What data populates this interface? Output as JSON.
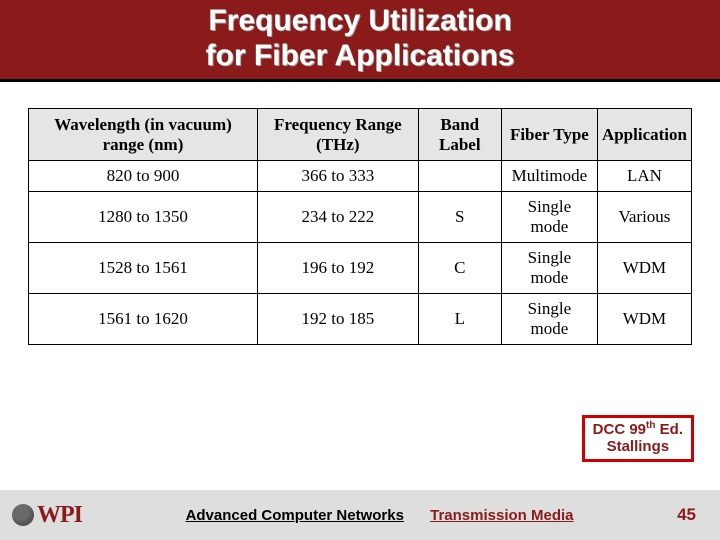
{
  "title_line1": "Frequency Utilization",
  "title_line2": "for Fiber Applications",
  "chart_data": {
    "type": "table",
    "headers": [
      "Wavelength (in vacuum) range (nm)",
      "Frequency Range (THz)",
      "Band Label",
      "Fiber Type",
      "Application"
    ],
    "rows": [
      {
        "wavelength": "820 to 900",
        "frequency": "366 to 333",
        "band": "",
        "fiber": "Multimode",
        "app": "LAN"
      },
      {
        "wavelength": "1280 to 1350",
        "frequency": "234 to 222",
        "band": "S",
        "fiber": "Single mode",
        "app": "Various"
      },
      {
        "wavelength": "1528 to 1561",
        "frequency": "196 to 192",
        "band": "C",
        "fiber": "Single mode",
        "app": "WDM"
      },
      {
        "wavelength": "1561 to 1620",
        "frequency": "192 to 185",
        "band": "L",
        "fiber": "Single mode",
        "app": "WDM"
      }
    ]
  },
  "credit": {
    "line1_a": "DCC 99",
    "line1_sup": "th",
    "line1_b": " Ed.",
    "line2": "Stallings"
  },
  "footer": {
    "logo_text": "WPI",
    "course": "Advanced Computer Networks",
    "topic": "Transmission Media",
    "slide": "45"
  }
}
